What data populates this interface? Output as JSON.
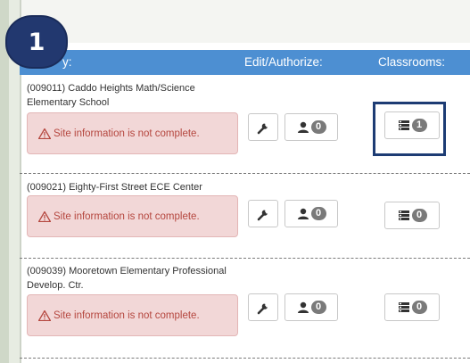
{
  "step_badge": "1",
  "table": {
    "col_site": "y:",
    "col_edit": "Edit/Authorize:",
    "col_classrooms": "Classrooms:"
  },
  "rows": [
    {
      "name": "(009011) Caddo Heights Math/Science Elementary School",
      "alert": "Site information is not complete.",
      "users_count": "0",
      "classrooms_count": "1"
    },
    {
      "name": "(009021) Eighty-First Street ECE Center",
      "alert": "Site information is not complete.",
      "users_count": "0",
      "classrooms_count": "0"
    },
    {
      "name": "(009039) Mooretown Elementary Professional Develop. Ctr.",
      "alert": "Site information is not complete.",
      "users_count": "0",
      "classrooms_count": "0"
    }
  ],
  "colors": {
    "header": "#4d8fd2",
    "step_badge": "#22386f",
    "alert_bg": "#f2d7d7",
    "alert_text": "#b5473f",
    "highlight": "#1d3c74"
  },
  "icons": [
    "warning-icon",
    "wrench-icon",
    "user-icon",
    "classroom-list-icon"
  ]
}
